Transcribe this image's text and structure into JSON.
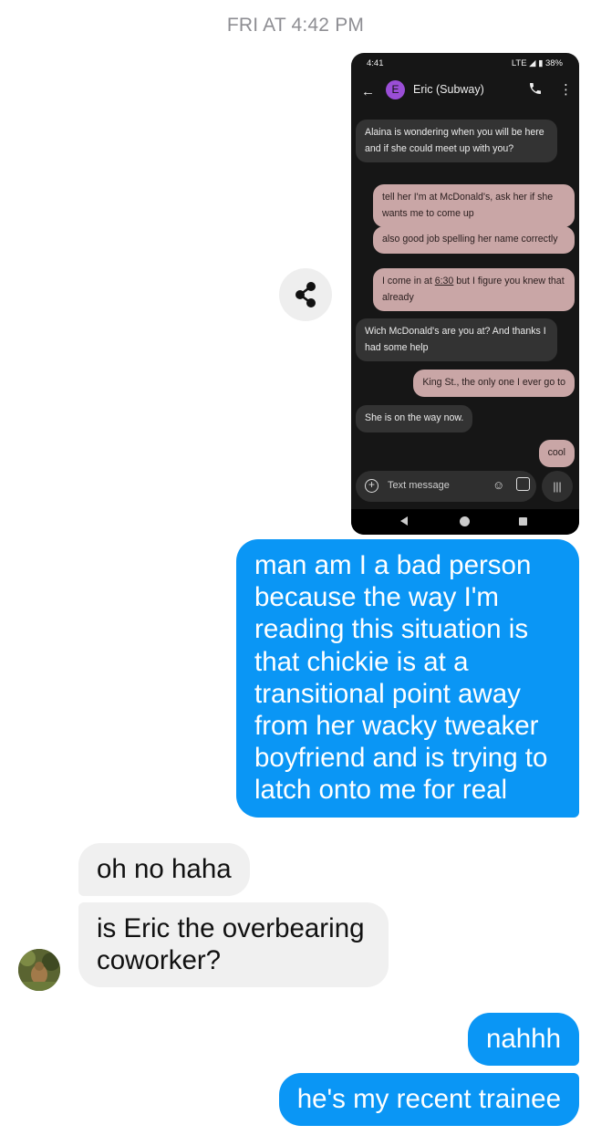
{
  "timestamp": "FRI AT 4:42 PM",
  "screenshot": {
    "status_time": "4:41",
    "status_right": "LTE ◢ ▮ 38%",
    "header": {
      "avatar_letter": "E",
      "contact_name": "Eric (Subway)",
      "back_icon": "arrow-left-icon",
      "call_icon": "phone-icon",
      "more_icon": "more-vertical-icon"
    },
    "messages": [
      {
        "dir": "in",
        "text": "Alaina is wondering when you will be here and if she could meet up with you?"
      },
      {
        "dir": "out",
        "text": "tell her I'm at McDonald's, ask her if she wants me to come up"
      },
      {
        "dir": "out",
        "text": "also good job spelling her name correctly"
      },
      {
        "dir": "out",
        "text_before": "I come in at ",
        "text_link": "6:30",
        "text_after": " but I figure you knew that already"
      },
      {
        "dir": "in",
        "text": "Wich McDonald's are you at? And thanks I had some help"
      },
      {
        "dir": "out",
        "text": "King St., the only one I ever go to"
      },
      {
        "dir": "in",
        "text": "She is on the way now."
      },
      {
        "dir": "out",
        "text": "cool"
      }
    ],
    "compose_placeholder": "Text message",
    "compose_icons": [
      "add-circle-icon",
      "emoji-icon",
      "gallery-icon",
      "voice-icon"
    ],
    "nav_icons": [
      "nav-back-icon",
      "nav-home-icon",
      "nav-recents-icon"
    ]
  },
  "share_icon": "share-icon",
  "chat": [
    {
      "from": "me",
      "text": "man am I a bad person because the way I'm reading this situation is that chickie is at a transitional point away from her wacky tweaker boyfriend and is trying to latch onto me for real"
    },
    {
      "from": "them",
      "text": "oh no haha"
    },
    {
      "from": "them",
      "text": "is Eric the overbearing coworker?"
    },
    {
      "from": "me",
      "text": "nahhh"
    },
    {
      "from": "me",
      "text": "he's my recent trainee"
    }
  ],
  "colors": {
    "outgoing_bubble": "#0a96f5",
    "incoming_bubble": "#f0f0f0",
    "sms_outgoing": "#c9a6a6",
    "sms_incoming": "#333333"
  }
}
